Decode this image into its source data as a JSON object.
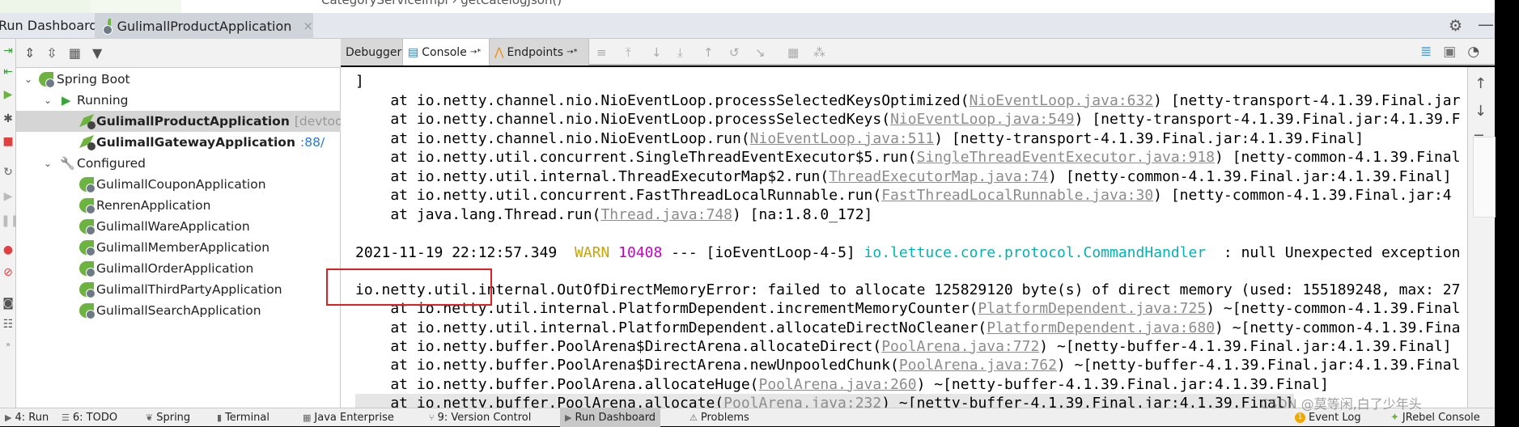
{
  "editor_breadcrumb": {
    "class": "CategoryServiceImpl",
    "separator": "›",
    "method": "getCatelogJson()"
  },
  "run_dashboard": {
    "label": "Run Dashboard:",
    "tab": "GulimallProductApplication",
    "close": "×"
  },
  "tree_toolbar": [
    "expand-all-icon",
    "collapse-all-icon",
    "group-icon",
    "filter-icon"
  ],
  "tree": {
    "root": "Spring Boot",
    "running_label": "Running",
    "running": [
      {
        "name": "GulimallProductApplication",
        "suffix": "[devtools]",
        "selected": true
      },
      {
        "name": "GulimallGatewayApplication",
        "suffix": ":88/"
      }
    ],
    "configured_label": "Configured",
    "configured": [
      "GulimallCouponApplication",
      "RenrenApplication",
      "GulimallWareApplication",
      "GulimallMemberApplication",
      "GulimallOrderApplication",
      "GulimallThirdPartyApplication",
      "GulimallSearchApplication"
    ]
  },
  "console_tabs": {
    "debugger": "Debugger",
    "console": "Console",
    "endpoints": "Endpoints",
    "pin": "→*"
  },
  "console": {
    "lines": [
      [
        {
          "t": "]"
        }
      ],
      [
        {
          "t": "    at io.netty.channel.nio.NioEventLoop.processSelectedKeysOptimized("
        },
        {
          "t": "NioEventLoop.java:632",
          "c": "link"
        },
        {
          "t": ") [netty-transport-4.1.39.Final.jar"
        }
      ],
      [
        {
          "t": "    at io.netty.channel.nio.NioEventLoop.processSelectedKeys("
        },
        {
          "t": "NioEventLoop.java:549",
          "c": "link"
        },
        {
          "t": ") [netty-transport-4.1.39.Final.jar:4.1.39.F"
        }
      ],
      [
        {
          "t": "    at io.netty.channel.nio.NioEventLoop.run("
        },
        {
          "t": "NioEventLoop.java:511",
          "c": "link"
        },
        {
          "t": ") [netty-transport-4.1.39.Final.jar:4.1.39.Final]"
        }
      ],
      [
        {
          "t": "    at io.netty.util.concurrent.SingleThreadEventExecutor$5.run("
        },
        {
          "t": "SingleThreadEventExecutor.java:918",
          "c": "link"
        },
        {
          "t": ") [netty-common-4.1.39.Final"
        }
      ],
      [
        {
          "t": "    at io.netty.util.internal.ThreadExecutorMap$2.run("
        },
        {
          "t": "ThreadExecutorMap.java:74",
          "c": "link"
        },
        {
          "t": ") [netty-common-4.1.39.Final.jar:4.1.39.Final]"
        }
      ],
      [
        {
          "t": "    at io.netty.util.concurrent.FastThreadLocalRunnable.run("
        },
        {
          "t": "FastThreadLocalRunnable.java:30",
          "c": "link"
        },
        {
          "t": ") [netty-common-4.1.39.Final.jar:4"
        }
      ],
      [
        {
          "t": "    at java.lang.Thread.run("
        },
        {
          "t": "Thread.java:748",
          "c": "link"
        },
        {
          "t": ") [na:1.8.0_172]"
        }
      ],
      [],
      [
        {
          "t": "2021-11-19 22:12:57.349  "
        },
        {
          "t": "WARN",
          "c": "warn"
        },
        {
          "t": " "
        },
        {
          "t": "10408",
          "c": "pid"
        },
        {
          "t": " --- [ioEventLoop-4-5] "
        },
        {
          "t": "io.lettuce.core.protocol.CommandHandler",
          "c": "logger"
        },
        {
          "t": "  : null Unexpected exception"
        }
      ],
      [],
      [
        {
          "t": "io.netty.util.internal.OutOfDirectMemoryError: failed to allocate 125829120 byte(s) of direct memory (used: 155189248, max: 27"
        }
      ],
      [
        {
          "t": "    at io.netty.util.internal.PlatformDependent.incrementMemoryCounter("
        },
        {
          "t": "PlatformDependent.java:725",
          "c": "link"
        },
        {
          "t": ") ~[netty-common-4.1.39.Final"
        }
      ],
      [
        {
          "t": "    at io.netty.util.internal.PlatformDependent.allocateDirectNoCleaner("
        },
        {
          "t": "PlatformDependent.java:680",
          "c": "link"
        },
        {
          "t": ") ~[netty-common-4.1.39.Fina"
        }
      ],
      [
        {
          "t": "    at io.netty.buffer.PoolArena$DirectArena.allocateDirect("
        },
        {
          "t": "PoolArena.java:772",
          "c": "link"
        },
        {
          "t": ") ~[netty-buffer-4.1.39.Final.jar:4.1.39.Final]"
        }
      ],
      [
        {
          "t": "    at io.netty.buffer.PoolArena$DirectArena.newUnpooledChunk("
        },
        {
          "t": "PoolArena.java:762",
          "c": "link"
        },
        {
          "t": ") ~[netty-buffer-4.1.39.Final.jar:4.1.39.Final"
        }
      ],
      [
        {
          "t": "    at io.netty.buffer.PoolArena.allocateHuge("
        },
        {
          "t": "PoolArena.java:260",
          "c": "link"
        },
        {
          "t": ") ~[netty-buffer-4.1.39.Final.jar:4.1.39.Final]"
        }
      ],
      [
        {
          "t": "    at io.netty.buffer.PoolArena.allocate("
        },
        {
          "t": "PoolArena.java:232",
          "c": "link"
        },
        {
          "t": ") ~[netty-buffer-4.1.39.Final.jar:4.1.39.Final]"
        }
      ]
    ]
  },
  "bottom_bar": {
    "items": [
      {
        "label": "4: Run",
        "icon": "play-icon"
      },
      {
        "label": "6: TODO",
        "icon": "list-icon"
      },
      {
        "label": "Spring",
        "icon": "spring-icon"
      },
      {
        "label": "Terminal",
        "icon": "terminal-icon"
      },
      {
        "label": "Java Enterprise",
        "icon": "java-enterprise-icon"
      },
      {
        "label": "9: Version Control",
        "icon": "version-control-icon"
      },
      {
        "label": "Run Dashboard",
        "icon": "run-dashboard-icon",
        "active": true
      },
      {
        "label": "Problems",
        "icon": "warning-icon"
      }
    ],
    "event_log": {
      "label": "Event Log",
      "badge": "1"
    },
    "jrebel": "JRebel Console"
  },
  "watermark": "CSDN @莫等闲,白了少年头",
  "colors": {
    "warn": "#c9a400",
    "pid": "#c800c8",
    "logger": "#00b4b4",
    "highlight_box": "#e02020",
    "spring": "#6db33f"
  }
}
